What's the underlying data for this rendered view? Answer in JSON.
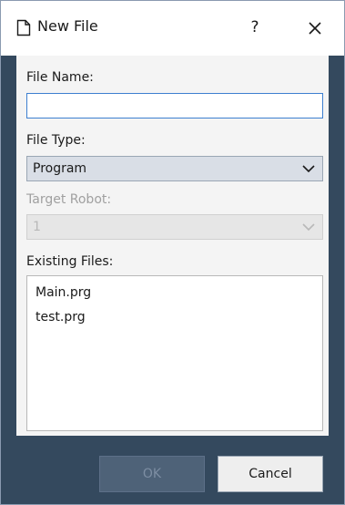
{
  "titlebar": {
    "title": "New File",
    "help_label": "?",
    "icon": "document-icon"
  },
  "form": {
    "file_name_label": "File Name:",
    "file_name_value": "",
    "file_type_label": "File Type:",
    "file_type_value": "Program",
    "target_robot_label": "Target Robot:",
    "target_robot_value": "1",
    "existing_files_label": "Existing Files:",
    "existing_files": [
      "Main.prg",
      "test.prg"
    ]
  },
  "buttons": {
    "ok_label": "OK",
    "cancel_label": "Cancel"
  },
  "colors": {
    "frame": "#34495e",
    "panel": "#f4f4f4",
    "select_bg": "#d9dee6",
    "focus_border": "#3d7fd0"
  }
}
